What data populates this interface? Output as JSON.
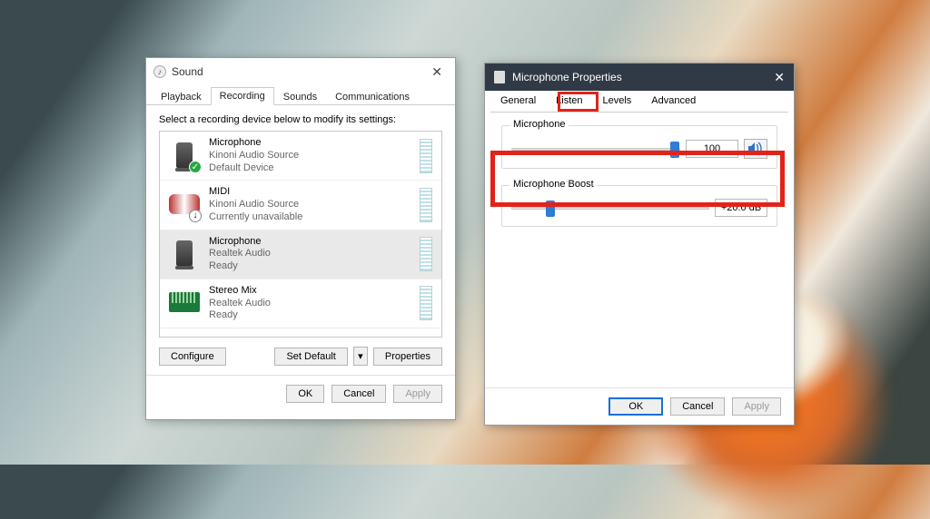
{
  "sound": {
    "title": "Sound",
    "tabs": [
      "Playback",
      "Recording",
      "Sounds",
      "Communications"
    ],
    "active_tab": "Recording",
    "instruction": "Select a recording device below to modify its settings:",
    "devices": [
      {
        "title": "Microphone",
        "line2": "Kinoni Audio Source",
        "line3": "Default Device",
        "icon": "mic",
        "badge": "check",
        "selected": false
      },
      {
        "title": "MIDI",
        "line2": "Kinoni Audio Source",
        "line3": "Currently unavailable",
        "icon": "midi",
        "badge": "down",
        "selected": false
      },
      {
        "title": "Microphone",
        "line2": "Realtek Audio",
        "line3": "Ready",
        "icon": "mic",
        "badge": null,
        "selected": true
      },
      {
        "title": "Stereo Mix",
        "line2": "Realtek Audio",
        "line3": "Ready",
        "icon": "mixer",
        "badge": null,
        "selected": false
      }
    ],
    "buttons": {
      "configure": "Configure",
      "set_default": "Set Default",
      "properties": "Properties"
    },
    "footer": {
      "ok": "OK",
      "cancel": "Cancel",
      "apply": "Apply"
    }
  },
  "mic": {
    "title": "Microphone Properties",
    "tabs": [
      "General",
      "Listen",
      "Levels",
      "Advanced"
    ],
    "active_tab": "Levels",
    "mic_level": {
      "label": "Microphone",
      "value": "100",
      "pct": 100
    },
    "boost": {
      "label": "Microphone Boost",
      "value": "+20.0 dB",
      "pct": 17
    },
    "footer": {
      "ok": "OK",
      "cancel": "Cancel",
      "apply": "Apply"
    }
  },
  "highlights": {
    "tab": "Levels",
    "section": "Microphone Boost"
  }
}
